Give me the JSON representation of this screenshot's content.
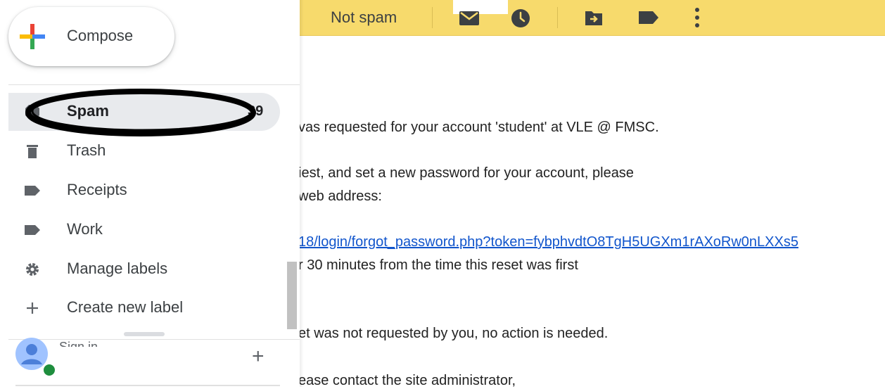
{
  "toolbar": {
    "not_spam_label": "Not spam",
    "icons": [
      "mark-unread-icon",
      "snooze-icon",
      "move-to-icon",
      "label-icon",
      "more-vert-icon"
    ]
  },
  "sidebar": {
    "compose_label": "Compose",
    "items": [
      {
        "label": "Spam",
        "count": "39",
        "icon": "spam-icon",
        "selected": true
      },
      {
        "label": "Trash",
        "icon": "trash-icon"
      },
      {
        "label": "Receipts",
        "icon": "label-icon"
      },
      {
        "label": "Work",
        "icon": "label-icon"
      },
      {
        "label": "Manage labels",
        "icon": "gear-icon"
      },
      {
        "label": "Create new label",
        "icon": "plus-icon"
      }
    ],
    "footer_text": "Sign in",
    "footer_plus": "+"
  },
  "email": {
    "lines": [
      "vas requested for your account 'student' at VLE @ FMSC.",
      "iest, and set a new password for your account, please",
      "web address:",
      "18/login/forgot_password.php?token=fybphvdtO8TgH5UGXm1rAXoRw0nLXXs5",
      "r 30 minutes from the time this reset was first",
      "et was not requested by you, no action is needed.",
      "ease contact the site administrator,"
    ]
  },
  "colors": {
    "toolbar_bg": "#f7da6c",
    "selected_bg": "#e8eaed",
    "link": "#1155cc",
    "annotation_ellipse": "#000000"
  }
}
